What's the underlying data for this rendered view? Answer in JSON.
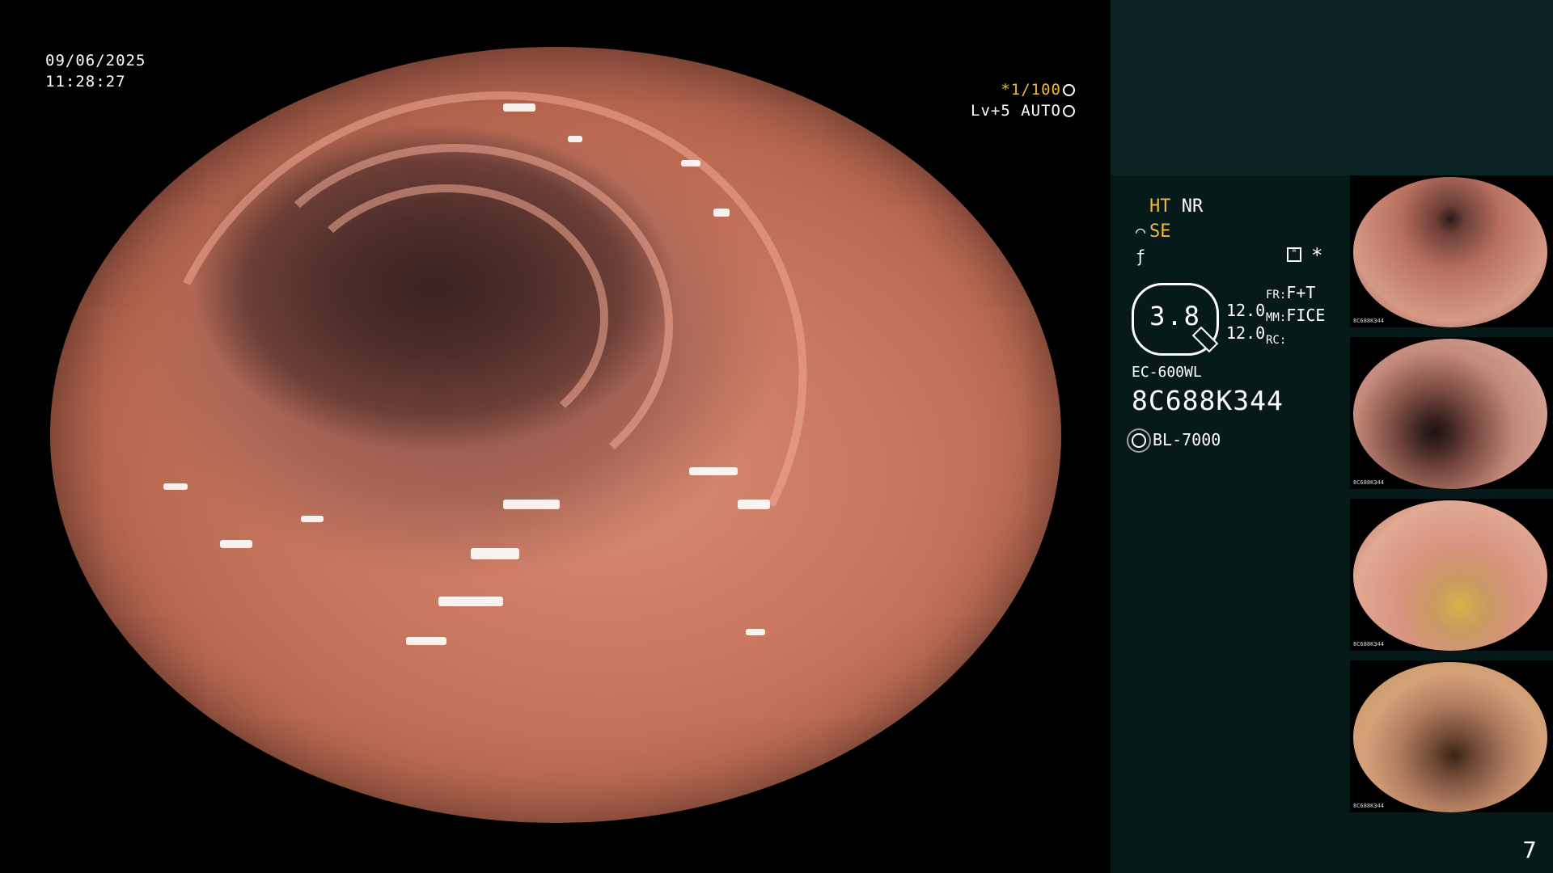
{
  "live_view": {
    "date": "09/06/2025",
    "time": "11:28:27",
    "shutter": "*1/100",
    "level": "Lv+5",
    "exposure_mode": "AUTO"
  },
  "panel": {
    "settings": {
      "ht": "HT",
      "nr": "NR",
      "se": "SE"
    },
    "zoom": "3.8",
    "mm_values": [
      "12.0",
      "12.0"
    ],
    "modes": [
      {
        "key": "FR:",
        "value": "F+T"
      },
      {
        "key": "MM:",
        "value": "FICE"
      },
      {
        "key": "RC:",
        "value": ""
      }
    ],
    "scope_model": "EC-600WL",
    "serial": "8C688K344",
    "light_source": "BL-7000",
    "thumbnail_label": "8C688K344",
    "page_number": "7"
  },
  "colors": {
    "accent": "#f0b73c",
    "panel_bg": "#071a1a",
    "panel_top": "#0c2424"
  }
}
